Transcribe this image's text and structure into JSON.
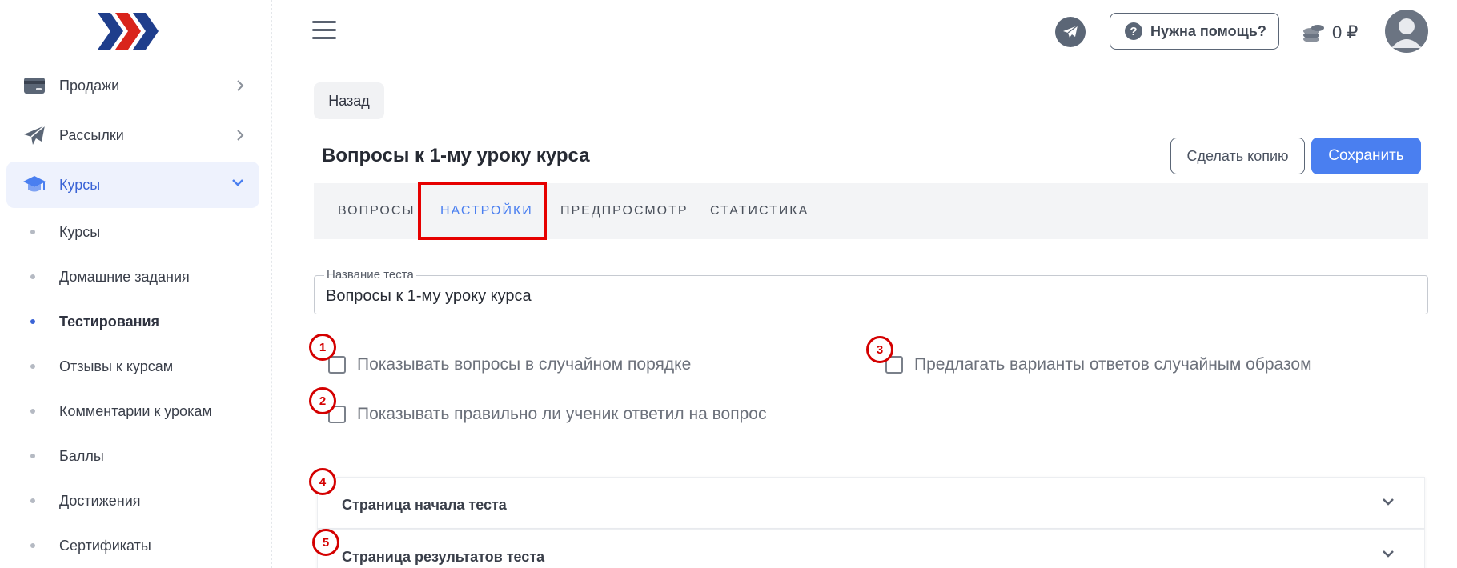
{
  "sidebar": {
    "items": [
      {
        "label": "Продажи",
        "icon": "card-icon"
      },
      {
        "label": "Рассылки",
        "icon": "paper-plane-icon"
      },
      {
        "label": "Курсы",
        "icon": "graduation-cap-icon"
      }
    ],
    "subitems": [
      {
        "label": "Курсы"
      },
      {
        "label": "Домашние задания"
      },
      {
        "label": "Тестирования"
      },
      {
        "label": "Отзывы к курсам"
      },
      {
        "label": "Комментарии к урокам"
      },
      {
        "label": "Баллы"
      },
      {
        "label": "Достижения"
      },
      {
        "label": "Сертификаты"
      }
    ]
  },
  "header": {
    "help_label": "Нужна помощь?",
    "balance": "0 ₽"
  },
  "main": {
    "back_label": "Назад",
    "title": "Вопросы к 1-му уроку курса",
    "copy_label": "Сделать копию",
    "save_label": "Сохранить",
    "tabs": [
      {
        "label": "ВОПРОСЫ"
      },
      {
        "label": "НАСТРОЙКИ"
      },
      {
        "label": "ПРЕДПРОСМОТР"
      },
      {
        "label": "СТАТИСТИКА"
      }
    ],
    "test_name": {
      "label": "Название теста",
      "value": "Вопросы к 1-му уроку курса"
    },
    "options": [
      {
        "label": "Показывать вопросы в случайном порядке",
        "checked": false
      },
      {
        "label": "Показывать правильно ли ученик ответил на вопрос",
        "checked": false
      },
      {
        "label": "Предлагать варианты ответов случайным образом",
        "checked": false
      }
    ],
    "sections": [
      {
        "label": "Страница начала теста"
      },
      {
        "label": "Страница результатов теста"
      }
    ]
  },
  "annotations": {
    "markers": [
      "1",
      "2",
      "3",
      "4",
      "5"
    ],
    "color": "#d40000"
  },
  "colors": {
    "accent": "#4a7ff0",
    "brand_red": "#d9241c",
    "brand_blue": "#1f3e8c"
  }
}
